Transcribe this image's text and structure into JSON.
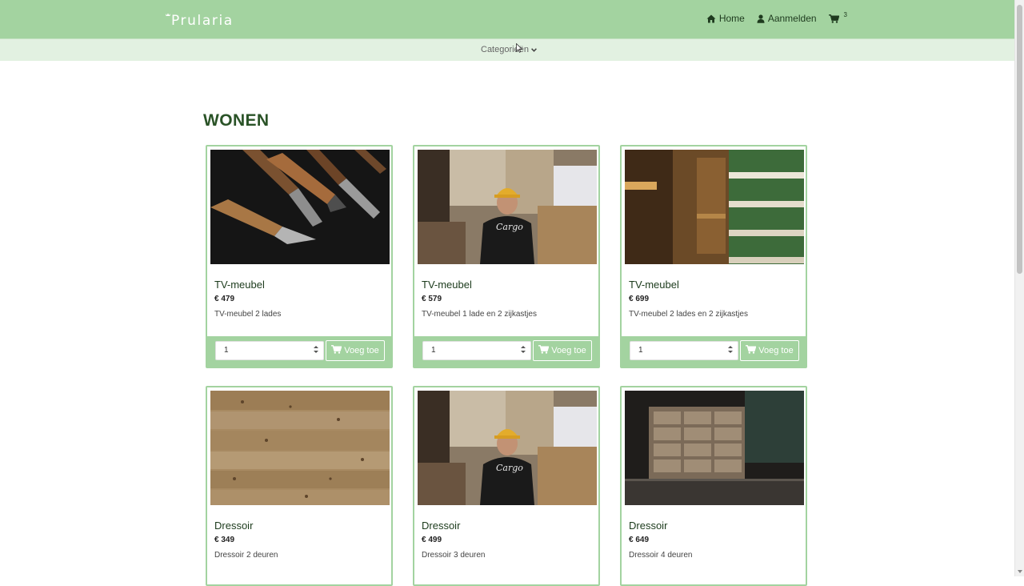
{
  "header": {
    "logo_text": "Prularia",
    "nav": {
      "home": "Home",
      "login": "Aanmelden",
      "cart_count": "3"
    },
    "categories_toggle": "Categorieën"
  },
  "main": {
    "title": "WONEN",
    "products": [
      {
        "name": "TV-meubel",
        "price": "€ 479",
        "description": "TV-meubel 2 lades",
        "qty": "1",
        "button": "Voeg toe",
        "image": "chisels-photo"
      },
      {
        "name": "TV-meubel",
        "price": "€ 579",
        "description": "TV-meubel 1 lade en 2 zijkastjes",
        "qty": "1",
        "button": "Voeg toe",
        "image": "workshop-man-photo"
      },
      {
        "name": "TV-meubel",
        "price": "€ 699",
        "description": "TV-meubel 2 lades en 2 zijkastjes",
        "qty": "1",
        "button": "Voeg toe",
        "image": "wooden-cabinet-photo"
      },
      {
        "name": "Dressoir",
        "price": "€ 349",
        "description": "Dressoir 2 deuren",
        "qty": "1",
        "button": "Voeg toe",
        "image": "wood-planks-photo"
      },
      {
        "name": "Dressoir",
        "price": "€ 499",
        "description": "Dressoir 3 deuren",
        "qty": "1",
        "button": "Voeg toe",
        "image": "workshop-man-photo"
      },
      {
        "name": "Dressoir",
        "price": "€ 649",
        "description": "Dressoir 4 deuren",
        "qty": "1",
        "button": "Voeg toe",
        "image": "drawer-cabinet-photo"
      }
    ]
  },
  "colors": {
    "navbar": "#a3d3a0",
    "subbar": "#e2f1e1",
    "title": "#2a5327",
    "card_border": "#a3d3a0"
  }
}
